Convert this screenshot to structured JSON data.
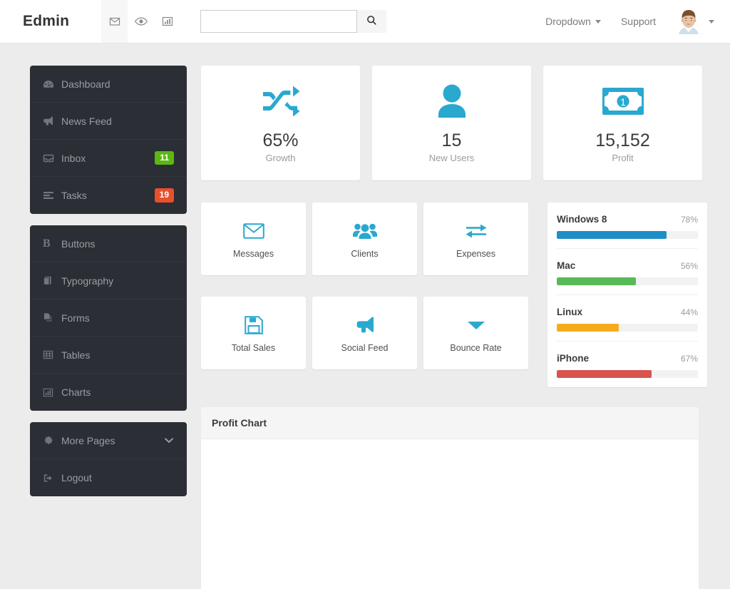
{
  "header": {
    "brand": "Edmin",
    "icons": [
      {
        "name": "envelope-icon",
        "label": "Messages"
      },
      {
        "name": "eye-icon",
        "label": "Views"
      },
      {
        "name": "bar-chart-icon",
        "label": "Statistics"
      }
    ],
    "search": {
      "value": "",
      "placeholder": "",
      "button_icon": "search-icon"
    },
    "links": [
      {
        "label": "Dropdown",
        "has_caret": true
      },
      {
        "label": "Support",
        "has_caret": false
      }
    ],
    "user": {
      "avatar": "avatar-image",
      "has_caret": true
    }
  },
  "sidebar": {
    "groups": [
      {
        "items": [
          {
            "label": "Dashboard",
            "icon": "dashboard-icon",
            "badge": null
          },
          {
            "label": "News Feed",
            "icon": "bullhorn-icon",
            "badge": null
          },
          {
            "label": "Inbox",
            "icon": "inbox-icon",
            "badge": {
              "text": "11",
              "color": "#5cb811"
            }
          },
          {
            "label": "Tasks",
            "icon": "tasks-icon",
            "badge": {
              "text": "19",
              "color": "#e8502d"
            }
          }
        ]
      },
      {
        "items": [
          {
            "label": "Buttons",
            "icon": "bold-b-icon",
            "badge": null
          },
          {
            "label": "Typography",
            "icon": "book-icon",
            "badge": null
          },
          {
            "label": "Forms",
            "icon": "copy-icon",
            "badge": null
          },
          {
            "label": "Tables",
            "icon": "table-icon",
            "badge": null
          },
          {
            "label": "Charts",
            "icon": "bar-chart-icon",
            "badge": null
          }
        ]
      },
      {
        "items": [
          {
            "label": "More Pages",
            "icon": "gear-icon",
            "badge": null,
            "chevron": "chevron-down-icon"
          },
          {
            "label": "Logout",
            "icon": "sign-out-icon",
            "badge": null
          }
        ]
      }
    ]
  },
  "main": {
    "stats": [
      {
        "icon": "shuffle-icon",
        "value": "65%",
        "label": "Growth"
      },
      {
        "icon": "user-icon",
        "value": "15",
        "label": "New Users"
      },
      {
        "icon": "money-bill-icon",
        "value": "15,152",
        "label": "Profit"
      }
    ],
    "tiles": [
      {
        "icon": "envelope-open-icon",
        "label": "Messages"
      },
      {
        "icon": "users-group-icon",
        "label": "Clients"
      },
      {
        "icon": "exchange-icon",
        "label": "Expenses"
      },
      {
        "icon": "floppy-save-icon",
        "label": "Total Sales"
      },
      {
        "icon": "bullhorn-icon",
        "label": "Social Feed"
      },
      {
        "icon": "caret-down-icon",
        "label": "Bounce Rate"
      }
    ],
    "progress": [
      {
        "name": "Windows 8",
        "percent": "78%",
        "value": 78,
        "color": "#1e8fc6"
      },
      {
        "name": "Mac",
        "percent": "56%",
        "value": 56,
        "color": "#58b957"
      },
      {
        "name": "Linux",
        "percent": "44%",
        "value": 44,
        "color": "#f6ab1f"
      },
      {
        "name": "iPhone",
        "percent": "67%",
        "value": 67,
        "color": "#d9534f"
      }
    ],
    "chart_panel": {
      "title": "Profit Chart"
    }
  },
  "colors": {
    "accent": "#29a9cf",
    "sidebar_bg": "#2b2e34",
    "page_bg": "#ececec"
  }
}
